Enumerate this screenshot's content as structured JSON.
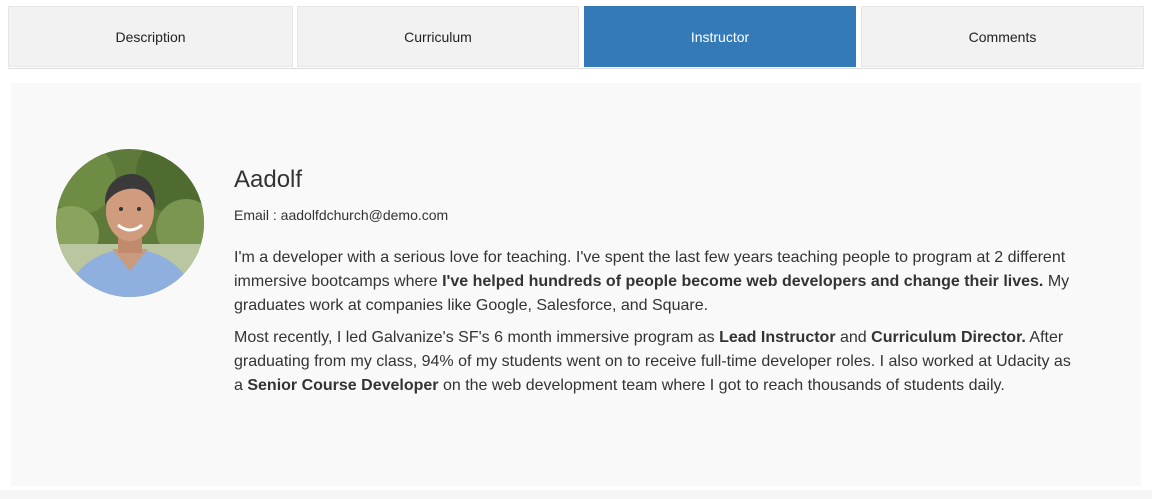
{
  "tabs": [
    {
      "label": "Description",
      "active": false
    },
    {
      "label": "Curriculum",
      "active": false
    },
    {
      "label": "Instructor",
      "active": true
    },
    {
      "label": "Comments",
      "active": false
    }
  ],
  "colors": {
    "active_tab": "#337ab7",
    "tab_bg": "#f2f2f2",
    "panel_bg": "#f9f9f9"
  },
  "instructor": {
    "name": "Aadolf",
    "email_label": "Email : aadolfdchurch@demo.com",
    "bio": {
      "p1": {
        "text1": "I'm a developer with a serious love for teaching. I've spent the last few years teaching people to program at 2 different immersive bootcamps where ",
        "bold1": "I've helped hundreds of people become web developers and change their lives.",
        "text2": " My graduates work at companies like Google, Salesforce, and Square."
      },
      "p2": {
        "text1": "Most recently, I led Galvanize's SF's 6 month immersive program as ",
        "bold1": "Lead Instructor",
        "text2": " and ",
        "bold2": "Curriculum Director.",
        "text3": " After graduating from my class, 94% of my students went on to receive full-time developer roles. I also worked at Udacity as a ",
        "bold3": "Senior Course Developer",
        "text4": " on the web development team where I got to reach thousands of students daily."
      }
    }
  }
}
